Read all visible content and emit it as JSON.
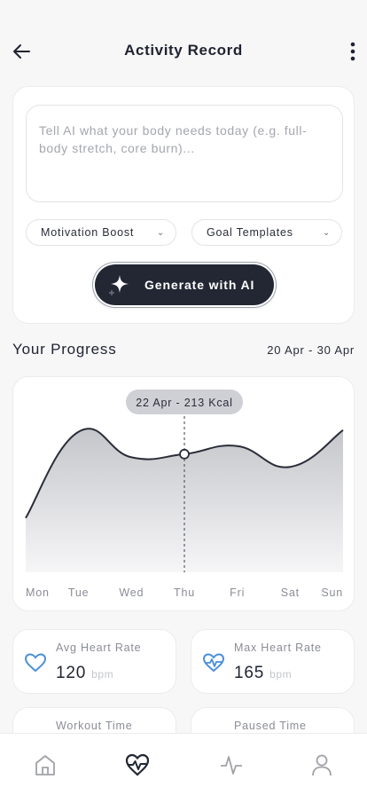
{
  "header": {
    "title": "Activity Record",
    "back_icon": "arrow-left-icon",
    "menu_icon": "more-vertical-icon"
  },
  "prompt": {
    "placeholder": "Tell AI what your body needs today (e.g. full-body stretch, core burn)..."
  },
  "selects": [
    {
      "label": "Motivation Boost"
    },
    {
      "label": "Goal Templates"
    }
  ],
  "generate": {
    "label": "Generate with AI",
    "icon": "sparkle-icon"
  },
  "progress": {
    "title": "Your Progress",
    "date_range": "20 Apr - 30 Apr",
    "tooltip": "22 Apr - 213 Kcal"
  },
  "chart_data": {
    "type": "area",
    "categories": [
      "Mon",
      "Tue",
      "Wed",
      "Thu",
      "Fri",
      "Sat",
      "Sun"
    ],
    "highlight": {
      "category": "Thu"
    },
    "series": [
      {
        "values": [
          34,
          88,
          72,
          74,
          79,
          66,
          89
        ]
      }
    ],
    "ylim": [
      0,
      100
    ],
    "grid": false,
    "legend": "none"
  },
  "stats": [
    {
      "label": "Avg Heart Rate",
      "value": "120",
      "unit": "bpm",
      "icon": "heart-icon"
    },
    {
      "label": "Max Heart Rate",
      "value": "165",
      "unit": "bpm",
      "icon": "heart-pulse-icon"
    },
    {
      "label": "Workout Time",
      "value": "",
      "unit": "",
      "icon": "timer-icon"
    },
    {
      "label": "Paused Time",
      "value": "",
      "unit": "",
      "icon": "pause-icon"
    }
  ],
  "nav": [
    {
      "icon": "home-icon"
    },
    {
      "icon": "heart-activity-icon",
      "active": true
    },
    {
      "icon": "activity-icon"
    },
    {
      "icon": "profile-icon"
    }
  ],
  "colors": {
    "accent": "#232734",
    "icon_blue": "#4a8fd8",
    "chart_line": "#2a2d38"
  }
}
